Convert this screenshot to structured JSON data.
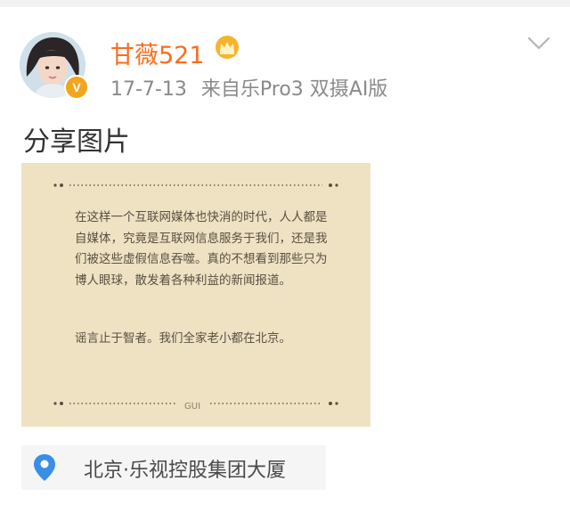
{
  "user": {
    "name": "甘薇521",
    "verified_badge": "V"
  },
  "meta": {
    "date": "17-7-13",
    "source": "来自乐Pro3 双摄AI版"
  },
  "post": {
    "text": "分享图片",
    "image": {
      "paragraph1": "在这样一个互联网媒体也快消的时代，人人都是自媒体，究竟是互联网信息服务于我们，还是我们被这些虚假信息吞噬。真的不想看到那些只为博人眼球，散发着各种利益的新闻报道。",
      "paragraph2": "谣言止于智者。我们全家老小都在北京。",
      "signature": "GUI"
    }
  },
  "location": {
    "text": "北京·乐视控股集团大厦",
    "icon": "location-pin-icon"
  },
  "colors": {
    "username": "#f86e1e",
    "meta": "#8a8a8a",
    "card_bg": "#eee2c3",
    "badge": "#f4a51c"
  }
}
